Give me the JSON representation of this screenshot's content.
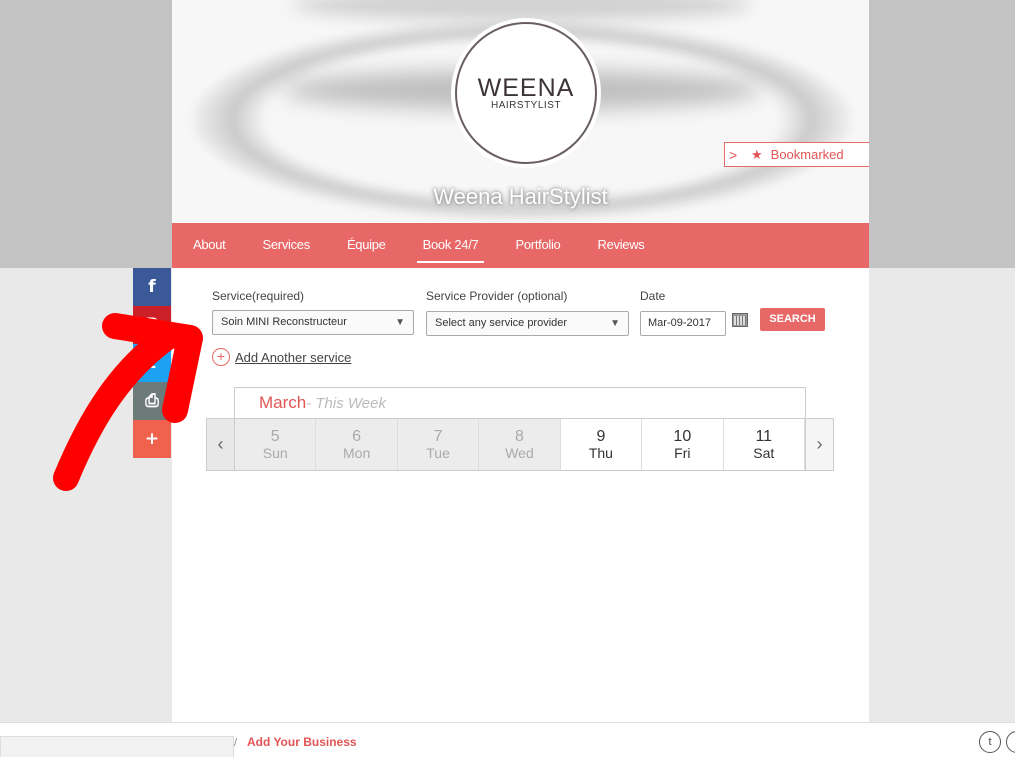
{
  "logo": {
    "title": "WEENA",
    "subtitle": "HAIRSTYLIST"
  },
  "business_name": "Weena HairStylist",
  "bookmark": {
    "label": "Bookmarked",
    "icon": "star-icon"
  },
  "nav": {
    "items": [
      "About",
      "Services",
      "Équipe",
      "Book 24/7",
      "Portfolio",
      "Reviews"
    ],
    "active": "Book 24/7"
  },
  "form": {
    "service_label": "Service(required)",
    "service_value": "Soin MINI Reconstructeur",
    "provider_label": "Service Provider (optional)",
    "provider_placeholder": "Select any service provider",
    "date_label": "Date",
    "date_value": "Mar-09-2017",
    "search_label": "SEARCH",
    "add_service_label": "Add Another service"
  },
  "calendar": {
    "month": "March",
    "week_label": "- This Week",
    "days": [
      {
        "num": "5",
        "dow": "Sun",
        "past": true
      },
      {
        "num": "6",
        "dow": "Mon",
        "past": true
      },
      {
        "num": "7",
        "dow": "Tue",
        "past": true
      },
      {
        "num": "8",
        "dow": "Wed",
        "past": true
      },
      {
        "num": "9",
        "dow": "Thu",
        "past": false
      },
      {
        "num": "10",
        "dow": "Fri",
        "past": false
      },
      {
        "num": "11",
        "dow": "Sat",
        "past": false
      }
    ]
  },
  "social": [
    {
      "icon": "facebook-icon",
      "glyph": "f",
      "color": "#3b5998"
    },
    {
      "icon": "pinterest-icon",
      "glyph": "P",
      "color": "#cb2027"
    },
    {
      "icon": "twitter-icon",
      "glyph": "t",
      "color": "#1da1f2"
    },
    {
      "icon": "print-icon",
      "glyph": "⎙",
      "color": "#6c7a7a"
    },
    {
      "icon": "more-icon",
      "glyph": "+",
      "color": "#f0624d"
    }
  ],
  "footer": {
    "add_business": "Add Your Business",
    "icons": [
      "twitter-icon",
      "circle-icon"
    ]
  },
  "colors": {
    "accent": "#e86767",
    "annotation": "#ff0000"
  }
}
